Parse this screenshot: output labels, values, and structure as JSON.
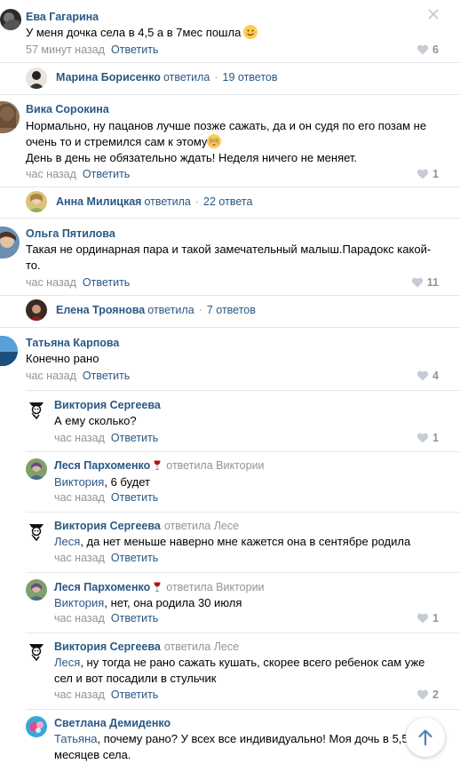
{
  "reply_label": "Ответить",
  "comments": [
    {
      "name": "Ева Гагарина",
      "text": "У меня дочка села в 4,5 а в 7мес пошла",
      "time": "57 минут назад",
      "likes": "6"
    },
    {
      "name": "Вика Сорокина",
      "text1": "Нормально, ну пацанов лучше позже сажать, да и он судя по его позам не",
      "text2": "очень то и стремился сам к этому",
      "text3": "День в день не обязательно ждать! Неделя ничего не меняет.",
      "time": "час назад",
      "likes": "1"
    },
    {
      "name": "Ольга Пятилова",
      "text1": "Такая не ординарная пара и такой замечательный малыш.Парадокс какой-",
      "text2": "то.",
      "time": "час назад",
      "likes": "11"
    },
    {
      "name": "Татьяна Карпова",
      "text": "Конечно рано",
      "time": "час назад",
      "likes": "4"
    }
  ],
  "summaries": [
    {
      "name": "Марина Борисенко",
      "verb": "ответила",
      "count": "19 ответов"
    },
    {
      "name": "Анна Милицкая",
      "verb": "ответила",
      "count": "22 ответа"
    },
    {
      "name": "Елена Троянова",
      "verb": "ответила",
      "count": "7 ответов"
    }
  ],
  "replies": [
    {
      "name": "Виктория Сергеева",
      "replyto": "",
      "mention": "",
      "text": "А ему сколько?",
      "time": "час назад",
      "likes": "1"
    },
    {
      "name": "Леся Пархоменко",
      "replyto": "ответила Виктории",
      "mention": "Виктория",
      "text": ", 6 будет",
      "time": "час назад",
      "likes": ""
    },
    {
      "name": "Виктория Сергеева",
      "replyto": "ответила Лесе",
      "mention": "Леся",
      "text": ", да нет меньше наверно мне кажется она в сентябре родила",
      "time": "час назад",
      "likes": ""
    },
    {
      "name": "Леся Пархоменко",
      "replyto": "ответила Виктории",
      "mention": "Виктория",
      "text": ", нет, она родила 30 июля",
      "time": "час назад",
      "likes": "1"
    },
    {
      "name": "Виктория Сергеева",
      "replyto": "ответила Лесе",
      "mention": "Леся",
      "text1": ", ну тогда не рано сажать кушать, скорее всего ребенок сам уже",
      "text2": "сел и вот посадили в стульчик",
      "time": "час назад",
      "likes": "2"
    },
    {
      "name": "Светлана Демиденко",
      "replyto": "",
      "mention": "Татьяна",
      "text1": ", почему рано? У всех все индивидуально! Моя дочь в 5,5",
      "text2": "месяцев села."
    }
  ],
  "icons": {
    "like": "heart-icon",
    "close": "close-icon",
    "scroll": "arrow-up-icon",
    "emoji_smile": "smiling-face-emoji",
    "emoji_flushed": "flushed-face-emoji",
    "wine": "wine-glass-icon"
  },
  "colors": {
    "link": "#2a5885",
    "muted": "#939393",
    "separator": "#e7e8ec"
  }
}
